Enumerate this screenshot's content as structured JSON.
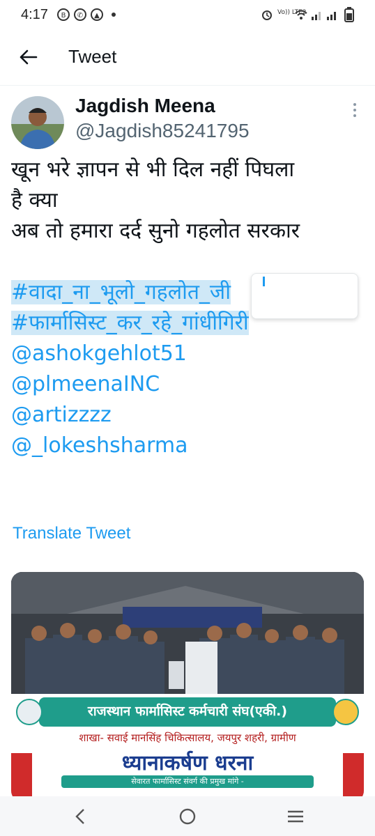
{
  "status_bar": {
    "time": "4:17",
    "left_icons": [
      "b-circle-icon",
      "whatsapp-icon",
      "a-circle-icon"
    ],
    "right_icons": [
      "alarm-icon",
      "volte-icon",
      "wifi-icon",
      "signal-icon",
      "signal-icon",
      "battery-icon"
    ],
    "volte_label": "Vo)) LTE2"
  },
  "app_bar": {
    "title": "Tweet",
    "back_icon": "arrow-left-icon"
  },
  "tweet": {
    "author": {
      "name": "Jagdish Meena",
      "handle": "@Jagdish85241795"
    },
    "lines": {
      "l1": "खून भरे ज्ञापन से भी दिल नहीं पिघला",
      "l2": "है क्या",
      "l3": "अब तो हमारा दर्द सुनो गहलोत सरकार",
      "h1": "#वादा_ना_भूलो_गहलोत_जी",
      "h2": "#फार्मासिस्ट_कर_रहे_गांधीगिरी",
      "m1": "@ashokgehlot51",
      "m2": "@plmeenaINC",
      "m3": "@artizzzz",
      "m4": "@_lokeshsharma"
    },
    "translate_label": "Translate Tweet",
    "link_color": "#1d9bf0"
  },
  "media_card": {
    "banner_title": "राजस्थान फार्मासिस्ट कर्मचारी संघ(एकी.)",
    "branch_line": "शाखा- सवाई मानसिंह चिकित्सालय, जयपुर शहरी, ग्रामीण",
    "headline": "ध्यानाकर्षण धरना",
    "subline": "सेवारत फार्मासिस्ट संवर्ग की प्रमुख मांगे -"
  },
  "nav_bar": {
    "icons": [
      "back-nav-icon",
      "home-nav-icon",
      "recents-nav-icon"
    ]
  }
}
